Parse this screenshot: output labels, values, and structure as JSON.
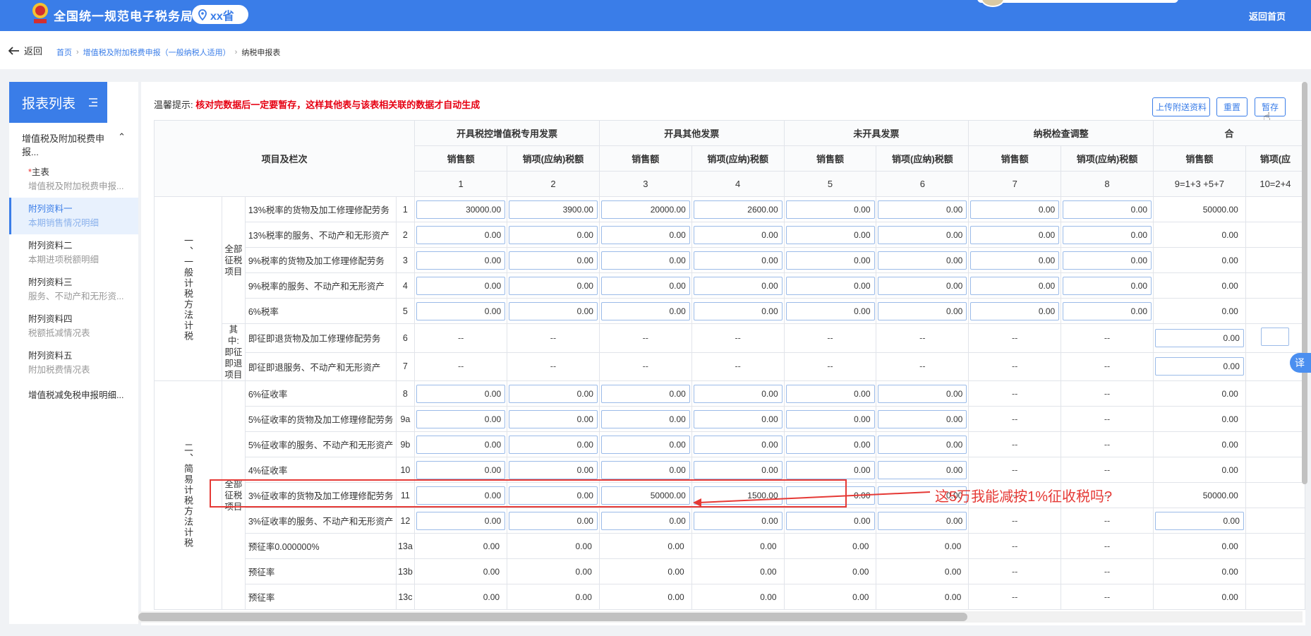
{
  "header": {
    "site_title": "全国统一规范电子税务局",
    "region": "xx省",
    "home_link": "返回首页"
  },
  "breadcrumb": {
    "back_label": "返回",
    "items": [
      "首页",
      "增值税及附加税费申报（一般纳税人适用）",
      "纳税申报表"
    ]
  },
  "sidebar": {
    "title": "报表列表",
    "group_label": "增值税及附加税费申报...",
    "items": [
      {
        "star": "*",
        "label": "主表",
        "sub": "增值税及附加税费申报..."
      },
      {
        "star": "",
        "label": "附列资料一",
        "sub": "本期销售情况明细"
      },
      {
        "star": "",
        "label": "附列资料二",
        "sub": "本期进项税额明细"
      },
      {
        "star": "",
        "label": "附列资料三",
        "sub": "服务、不动产和无形资..."
      },
      {
        "star": "",
        "label": "附列资料四",
        "sub": "税额抵减情况表"
      },
      {
        "star": "",
        "label": "附列资料五",
        "sub": "附加税费情况表"
      },
      {
        "star": "",
        "label": "增值税减免税申报明细...",
        "sub": ""
      }
    ]
  },
  "toolbar": {
    "tip_prefix": "温馨提示:",
    "tip_warning": "核对完数据后一定要暂存，这样其他表与该表相关联的数据才自动生成",
    "upload_label": "上传附送资料",
    "reset_label": "重置",
    "save_label": "暂存"
  },
  "table": {
    "item_header": "项目及栏次",
    "groups": [
      "开具税控增值税专用发票",
      "开具其他发票",
      "未开具发票",
      "纳税检查调整",
      "合"
    ],
    "subheaders": [
      "销售额",
      "销项(应纳)税额",
      "销售额",
      "销项(应纳)税额",
      "销售额",
      "销项(应纳)税额",
      "销售额",
      "销项(应纳)税额",
      "销售额",
      "销项(应"
    ],
    "colnums": [
      "1",
      "2",
      "3",
      "4",
      "5",
      "6",
      "7",
      "8",
      "9=1+3 +5+7",
      "10=2+4"
    ],
    "section1": "一、一般计税方法计税",
    "section2": "二、简易计税方法计税",
    "cat_all": "全部征税项目",
    "cat_refund": "其中:即征即退项目",
    "rows": [
      {
        "label": "13%税率的货物及加工修理修配劳务",
        "no": "1",
        "v": [
          "30000.00",
          "3900.00",
          "20000.00",
          "2600.00",
          "0.00",
          "0.00",
          "0.00",
          "0.00"
        ],
        "total": "50000.00"
      },
      {
        "label": "13%税率的服务、不动产和无形资产",
        "no": "2",
        "v": [
          "0.00",
          "0.00",
          "0.00",
          "0.00",
          "0.00",
          "0.00",
          "0.00",
          "0.00"
        ],
        "total": "0.00"
      },
      {
        "label": "9%税率的货物及加工修理修配劳务",
        "no": "3",
        "v": [
          "0.00",
          "0.00",
          "0.00",
          "0.00",
          "0.00",
          "0.00",
          "0.00",
          "0.00"
        ],
        "total": "0.00"
      },
      {
        "label": "9%税率的服务、不动产和无形资产",
        "no": "4",
        "v": [
          "0.00",
          "0.00",
          "0.00",
          "0.00",
          "0.00",
          "0.00",
          "0.00",
          "0.00"
        ],
        "total": "0.00"
      },
      {
        "label": "6%税率",
        "no": "5",
        "v": [
          "0.00",
          "0.00",
          "0.00",
          "0.00",
          "0.00",
          "0.00",
          "0.00",
          "0.00"
        ],
        "total": "0.00"
      },
      {
        "label": "即征即退货物及加工修理修配劳务",
        "no": "6",
        "dash": "--",
        "total": "0.00"
      },
      {
        "label": "即征即退服务、不动产和无形资产",
        "no": "7",
        "dash": "--",
        "total": "0.00"
      },
      {
        "label": "6%征收率",
        "no": "8",
        "v": [
          "0.00",
          "0.00",
          "0.00",
          "0.00",
          "0.00",
          "0.00"
        ],
        "total": "0.00"
      },
      {
        "label": "5%征收率的货物及加工修理修配劳务",
        "no": "9a",
        "v": [
          "0.00",
          "0.00",
          "0.00",
          "0.00",
          "0.00",
          "0.00"
        ],
        "total": "0.00"
      },
      {
        "label": "5%征收率的服务、不动产和无形资产",
        "no": "9b",
        "v": [
          "0.00",
          "0.00",
          "0.00",
          "0.00",
          "0.00",
          "0.00"
        ],
        "total": "0.00"
      },
      {
        "label": "4%征收率",
        "no": "10",
        "v": [
          "0.00",
          "0.00",
          "0.00",
          "0.00",
          "0.00",
          "0.00"
        ],
        "total": "0.00"
      },
      {
        "label": "3%征收率的货物及加工修理修配劳务",
        "no": "11",
        "v": [
          "0.00",
          "0.00",
          "50000.00",
          "1500.00",
          "0.00",
          "0.00"
        ],
        "total": "50000.00"
      },
      {
        "label": "3%征收率的服务、不动产和无形资产",
        "no": "12",
        "v": [
          "0.00",
          "0.00",
          "0.00",
          "0.00",
          "0.00",
          "0.00"
        ],
        "total": "0.00"
      },
      {
        "label": "预征率0.000000%",
        "no": "13a",
        "v": [
          "0.00",
          "0.00",
          "0.00",
          "0.00",
          "0.00",
          "0.00"
        ],
        "total": "0.00"
      },
      {
        "label": "预征率",
        "no": "13b",
        "v": [
          "0.00",
          "0.00",
          "0.00",
          "0.00",
          "0.00",
          "0.00"
        ],
        "total": "0.00"
      },
      {
        "label": "预征率",
        "no": "13c",
        "v": [
          "0.00",
          "0.00",
          "0.00",
          "0.00",
          "0.00",
          "0.00"
        ],
        "total": "0.00"
      }
    ]
  },
  "annotation": {
    "text": "这5万我能减按1%征收税吗?",
    "color": "#e53935"
  },
  "translate_badge": "译"
}
